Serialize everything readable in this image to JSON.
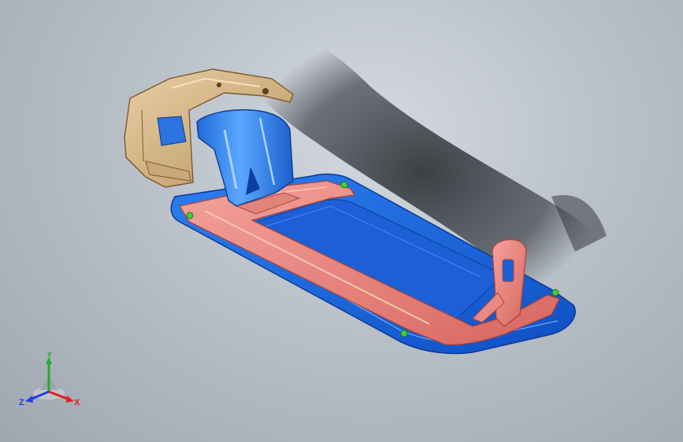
{
  "viewport": {
    "background_top": "#d4d9df",
    "background_bottom": "#9fa7b0"
  },
  "model": {
    "name": "",
    "part_colors": {
      "hinge_bracket": "#d9b98a",
      "hinge_arm": "#2f7fe6",
      "frame": "#e88a83",
      "base_plate": "#1a62d6",
      "fastener_points": "#3ed13a"
    }
  },
  "triad": {
    "x_label": "X",
    "y_label": "Y",
    "z_label": "Z",
    "x_color": "#e02020",
    "y_color": "#20b020",
    "z_color": "#2040e0"
  }
}
